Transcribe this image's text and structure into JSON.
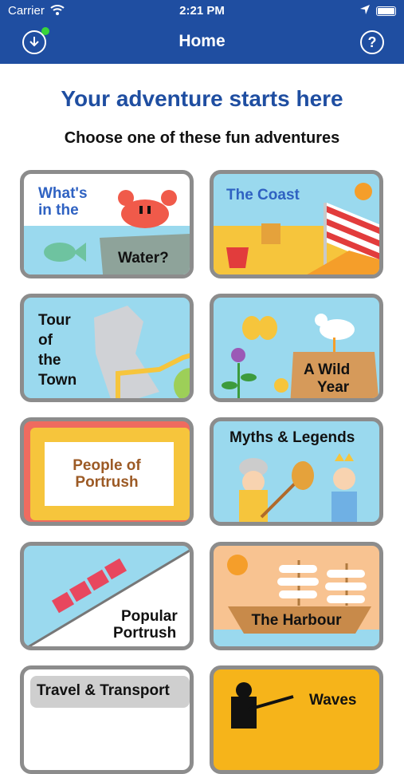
{
  "status": {
    "carrier": "Carrier",
    "time": "2:21 PM"
  },
  "nav": {
    "title": "Home",
    "download_icon": "download-icon",
    "help_icon": "help-icon"
  },
  "heading": "Your adventure starts here",
  "subheading": "Choose one of these fun adventures",
  "cards": [
    {
      "line1": "What's",
      "line2": "in the",
      "line3": "Water?"
    },
    {
      "label": "The Coast"
    },
    {
      "line1": "Tour",
      "line2": "of",
      "line3": "the",
      "line4": "Town"
    },
    {
      "line1": "A Wild",
      "line2": "Year"
    },
    {
      "line1": "People of",
      "line2": "Portrush"
    },
    {
      "label": "Myths & Legends"
    },
    {
      "line1": "Popular",
      "line2": "Portrush"
    },
    {
      "label": "The Harbour"
    },
    {
      "label": "Travel & Transport"
    },
    {
      "label": "Waves"
    }
  ],
  "colors": {
    "brand": "#1f4ea1",
    "card_border": "#8c8c8c"
  }
}
